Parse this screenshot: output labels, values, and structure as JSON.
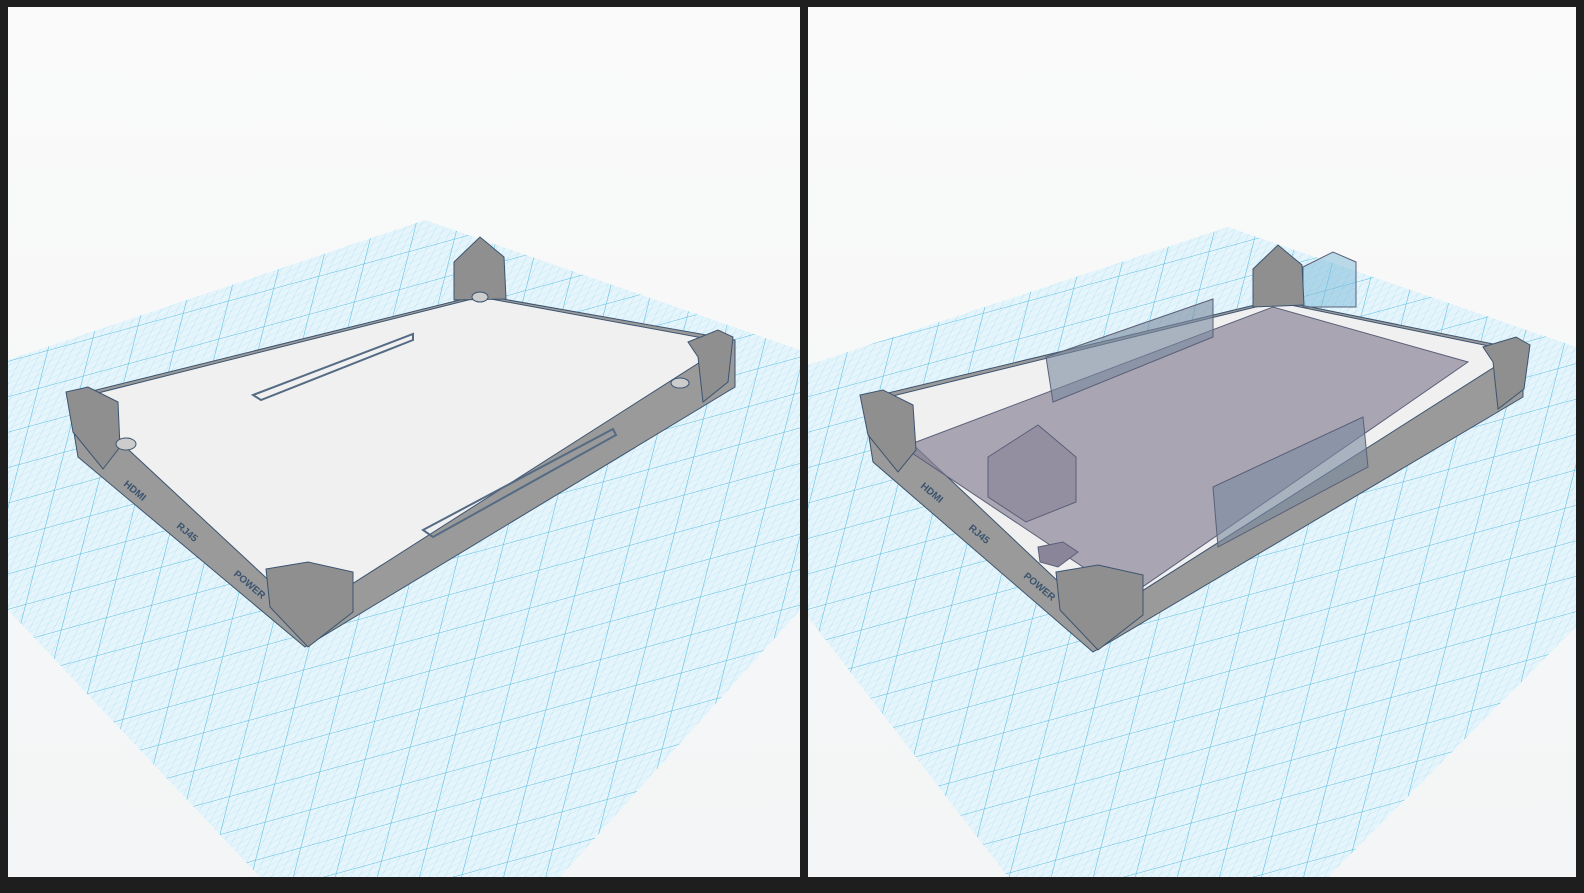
{
  "views": [
    {
      "name": "case-base-view",
      "labels": {
        "hdmi": "HDMI",
        "rj45": "RJ45",
        "power": "POWER"
      }
    },
    {
      "name": "case-with-board-view",
      "labels": {
        "hdmi": "HDMI",
        "rj45": "RJ45",
        "power": "POWER"
      }
    }
  ],
  "colors": {
    "grid": "#5cc3e6",
    "plate": "#f0f0f0",
    "wall": "#9a9a9a",
    "board": "#8a8598",
    "frame": "#1e1e1e"
  }
}
